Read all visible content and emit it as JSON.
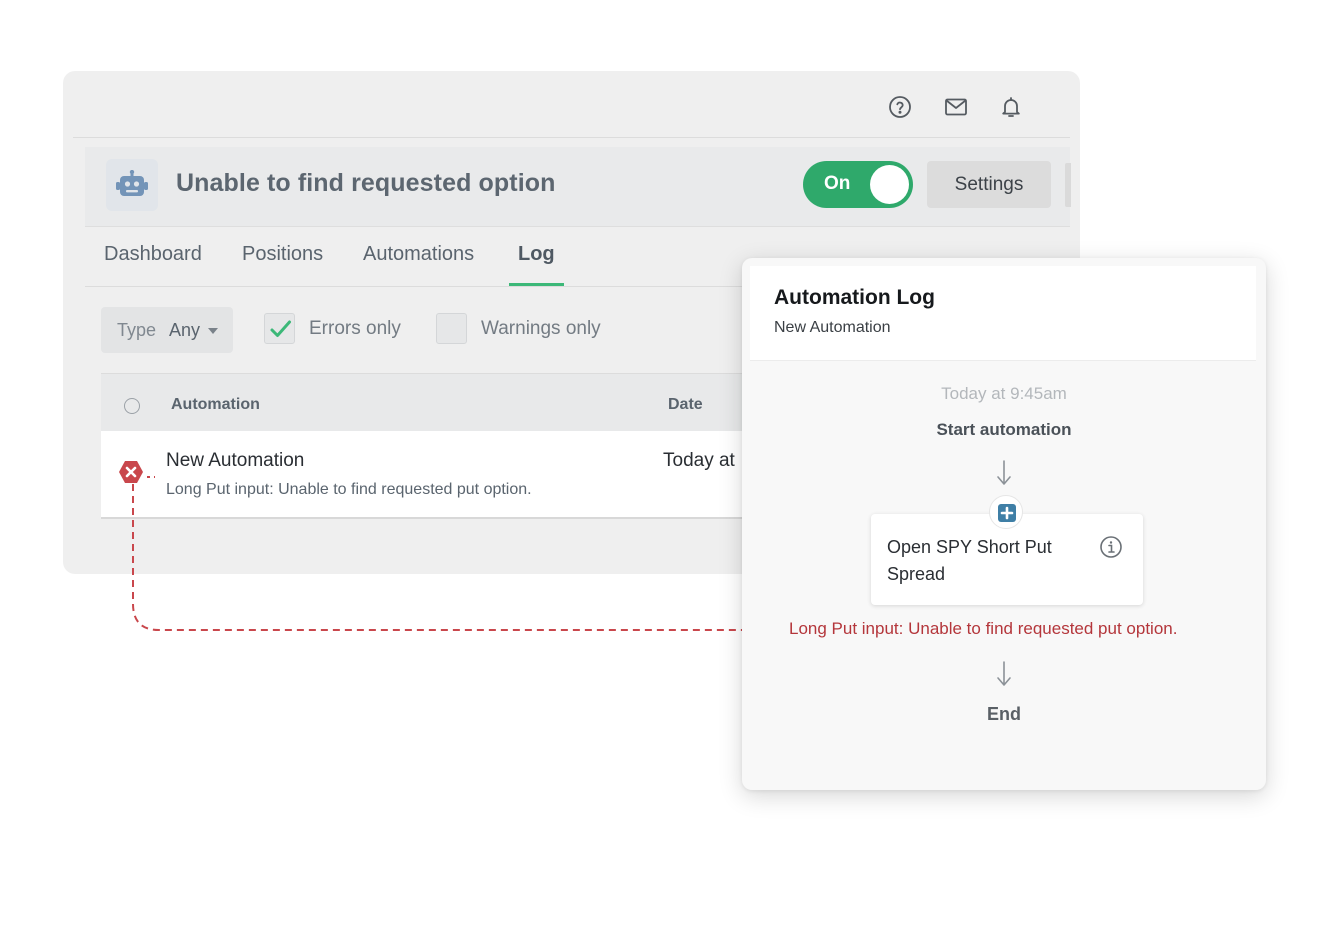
{
  "topbar": {
    "icons": [
      "help-circle-icon",
      "mail-icon",
      "bell-icon"
    ]
  },
  "header": {
    "title": "Unable to find requested option",
    "toggle_label": "On",
    "settings_label": "Settings"
  },
  "tabs": [
    {
      "label": "Dashboard",
      "active": false
    },
    {
      "label": "Positions",
      "active": false
    },
    {
      "label": "Automations",
      "active": false
    },
    {
      "label": "Log",
      "active": true
    }
  ],
  "filters": {
    "type_label": "Type",
    "type_value": "Any",
    "errors_only_label": "Errors only",
    "errors_only_checked": true,
    "warnings_only_label": "Warnings only",
    "warnings_only_checked": false
  },
  "table": {
    "columns": [
      "Automation",
      "Date"
    ],
    "rows": [
      {
        "title": "New Automation",
        "subtitle": "Long Put input: Unable to find requested put option.",
        "date": "Today at",
        "status": "error"
      }
    ]
  },
  "log_card": {
    "title": "Automation Log",
    "subtitle": "New Automation",
    "time": "Today at 9:45am",
    "start": "Start automation",
    "step_label": "Open SPY Short Put Spread",
    "error_message": "Long Put input: Unable to find requested put option.",
    "end": "End"
  },
  "colors": {
    "accent_green": "#2fa96b",
    "error_red": "#c9474c",
    "tab_underline": "#3cb878"
  }
}
